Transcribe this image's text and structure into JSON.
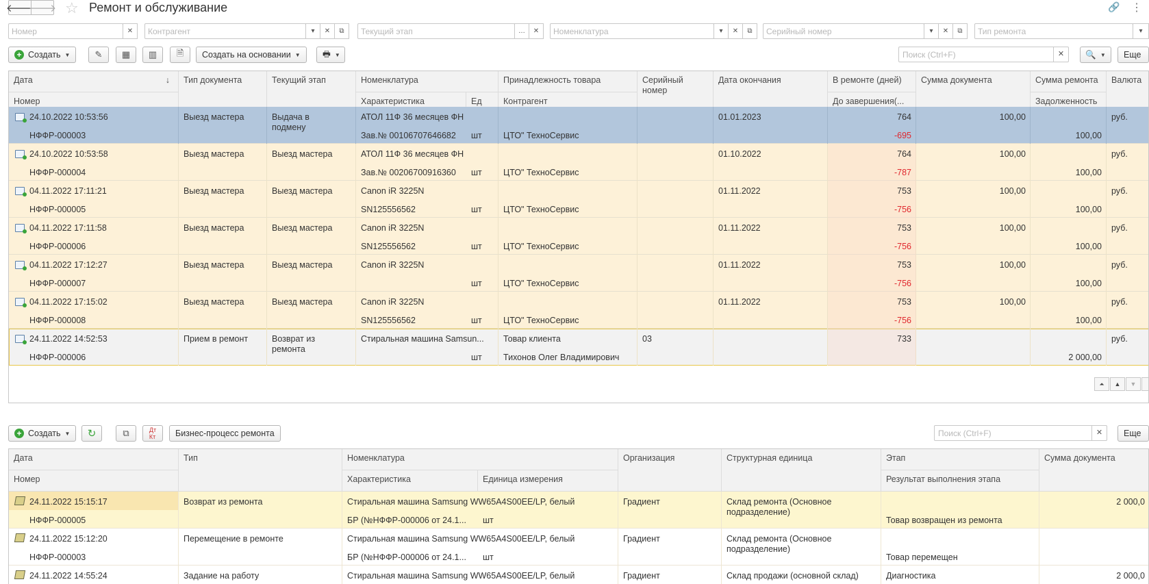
{
  "window": {
    "title": "Ремонт и обслуживание",
    "more_label": "Еще"
  },
  "filters": {
    "number_placeholder": "Номер",
    "contractor_placeholder": "Контрагент",
    "stage_placeholder": "Текущий этап",
    "nomenclature_placeholder": "Номенклатура",
    "serial_placeholder": "Серийный номер",
    "repair_type_placeholder": "Тип ремонта"
  },
  "toolbar": {
    "create_label": "Создать",
    "create_based_label": "Создать на основании",
    "search_placeholder": "Поиск (Ctrl+F)",
    "more_label": "Еще"
  },
  "main_table": {
    "headers": {
      "date": "Дата",
      "sort_arrow": "↓",
      "number": "Номер",
      "doc_type": "Тип документа",
      "stage": "Текущий этап",
      "nomenclature": "Номенклатура",
      "characteristic": "Характеристика",
      "unit": "Ед",
      "ownership": "Принадлежность товара",
      "contractor": "Контрагент",
      "serial": "Серийный номер",
      "end_date": "Дата окончания",
      "in_repair": "В ремонте (дней)",
      "to_completion": "До завершения(...",
      "doc_sum": "Сумма документа",
      "repair_sum": "Сумма ремонта",
      "debt": "Задолженность",
      "currency": "Валюта"
    },
    "rows": [
      {
        "date": "24.10.2022 10:53:56",
        "number": "НФФР-000003",
        "doc_type": "Выезд мастера",
        "stage": "Выдача в подмену",
        "nomenclature": "АТОЛ 11Ф 36 месяцев ФН",
        "characteristic": "Зав.№ 00106707646682",
        "unit": "шт",
        "ownership": "",
        "contractor": "ЦТО\" ТехноСервис",
        "serial": "",
        "end_date": "01.01.2023",
        "in_repair": "764",
        "to_completion": "-695",
        "doc_sum": "100,00",
        "repair_sum": "",
        "debt": "100,00",
        "currency": "руб."
      },
      {
        "date": "24.10.2022 10:53:58",
        "number": "НФФР-000004",
        "doc_type": "Выезд мастера",
        "stage": "Выезд мастера",
        "nomenclature": "АТОЛ 11Ф 36 месяцев ФН",
        "characteristic": "Зав.№ 00206700916360",
        "unit": "шт",
        "ownership": "",
        "contractor": "ЦТО\" ТехноСервис",
        "serial": "",
        "end_date": "01.10.2022",
        "in_repair": "764",
        "to_completion": "-787",
        "doc_sum": "100,00",
        "repair_sum": "",
        "debt": "100,00",
        "currency": "руб."
      },
      {
        "date": "04.11.2022 17:11:21",
        "number": "НФФР-000005",
        "doc_type": "Выезд мастера",
        "stage": "Выезд мастера",
        "nomenclature": "Canon iR 3225N",
        "characteristic": "SN125556562",
        "unit": "шт",
        "ownership": "",
        "contractor": "ЦТО\" ТехноСервис",
        "serial": "",
        "end_date": "01.11.2022",
        "in_repair": "753",
        "to_completion": "-756",
        "doc_sum": "100,00",
        "repair_sum": "",
        "debt": "100,00",
        "currency": "руб."
      },
      {
        "date": "04.11.2022 17:11:58",
        "number": "НФФР-000006",
        "doc_type": "Выезд мастера",
        "stage": "Выезд мастера",
        "nomenclature": "Canon iR 3225N",
        "characteristic": "SN125556562",
        "unit": "шт",
        "ownership": "",
        "contractor": "ЦТО\" ТехноСервис",
        "serial": "",
        "end_date": "01.11.2022",
        "in_repair": "753",
        "to_completion": "-756",
        "doc_sum": "100,00",
        "repair_sum": "",
        "debt": "100,00",
        "currency": "руб."
      },
      {
        "date": "04.11.2022 17:12:27",
        "number": "НФФР-000007",
        "doc_type": "Выезд мастера",
        "stage": "Выезд мастера",
        "nomenclature": "Canon iR 3225N",
        "characteristic": "",
        "unit": "шт",
        "ownership": "",
        "contractor": "ЦТО\" ТехноСервис",
        "serial": "",
        "end_date": "01.11.2022",
        "in_repair": "753",
        "to_completion": "-756",
        "doc_sum": "100,00",
        "repair_sum": "",
        "debt": "100,00",
        "currency": "руб."
      },
      {
        "date": "04.11.2022 17:15:02",
        "number": "НФФР-000008",
        "doc_type": "Выезд мастера",
        "stage": "Выезд мастера",
        "nomenclature": "Canon iR 3225N",
        "characteristic": "SN125556562",
        "unit": "шт",
        "ownership": "",
        "contractor": "ЦТО\" ТехноСервис",
        "serial": "",
        "end_date": "01.11.2022",
        "in_repair": "753",
        "to_completion": "-756",
        "doc_sum": "100,00",
        "repair_sum": "",
        "debt": "100,00",
        "currency": "руб."
      },
      {
        "date": "24.11.2022 14:52:53",
        "number": "НФФР-000006",
        "doc_type": "Прием в ремонт",
        "stage": "Возврат из ремонта",
        "nomenclature": "Стиральная машина Samsun...",
        "characteristic": "",
        "unit": "шт",
        "ownership": "Товар клиента",
        "contractor": "Тихонов Олег Владимирович",
        "serial": "03",
        "end_date": "",
        "in_repair": "733",
        "to_completion": "",
        "doc_sum": "",
        "repair_sum": "",
        "debt": "2 000,00",
        "currency": "руб."
      }
    ]
  },
  "sub_toolbar": {
    "create_label": "Создать",
    "business_process_label": "Бизнес-процесс ремонта",
    "search_placeholder": "Поиск (Ctrl+F)",
    "more_label": "Еще"
  },
  "sub_table": {
    "headers": {
      "date": "Дата",
      "number": "Номер",
      "type": "Тип",
      "nomenclature": "Номенклатура",
      "characteristic": "Характеристика",
      "unit": "Единица измерения",
      "organization": "Организация",
      "structural_unit": "Структурная единица",
      "stage": "Этап",
      "stage_result": "Результат выполнения этапа",
      "doc_sum": "Сумма документа"
    },
    "rows": [
      {
        "date": "24.11.2022 15:15:17",
        "number": "НФФР-000005",
        "type": "Возврат из ремонта",
        "nomenclature": "Стиральная машина Samsung WW65A4S00EE/LP, белый",
        "characteristic": "БР (№НФФР-000006 от 24.1...",
        "unit": "шт",
        "organization": "Градиент",
        "structural_unit": "Склад ремонта (Основное подразделение)",
        "stage": "",
        "stage_result": "Товар возвращен из ремонта",
        "doc_sum": "2 000,0"
      },
      {
        "date": "24.11.2022 15:12:20",
        "number": "НФФР-000003",
        "type": "Перемещение в ремонте",
        "nomenclature": "Стиральная машина Samsung WW65A4S00EE/LP, белый",
        "characteristic": "БР (№НФФР-000006 от 24.1...",
        "unit": "шт",
        "organization": "Градиент",
        "structural_unit": "Склад ремонта (Основное подразделение)",
        "stage": "",
        "stage_result": "Товар перемещен",
        "doc_sum": ""
      },
      {
        "date": "24.11.2022 14:55:24",
        "number": "",
        "type": "Задание на работу",
        "nomenclature": "Стиральная машина Samsung WW65A4S00EE/LP, белый",
        "characteristic": "",
        "unit": "",
        "organization": "Градиент",
        "structural_unit": "Склад продажи (основной склад)",
        "stage": "Диагностика",
        "stage_result": "",
        "doc_sum": "2 000,0"
      }
    ]
  },
  "colors": {
    "selected_row": "#b2c6dc",
    "row_highlight": "#fdf1d8",
    "current_row": "#fdf6cf",
    "negative": "#e0272d"
  }
}
